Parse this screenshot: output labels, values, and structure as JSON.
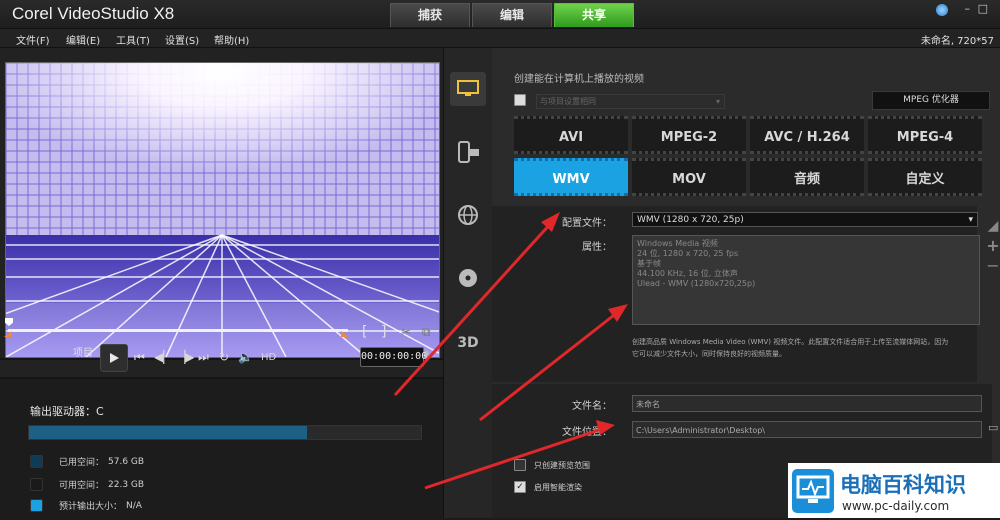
{
  "app": {
    "title": "Corel VideoStudio X8"
  },
  "tabs": [
    {
      "label": "捕获"
    },
    {
      "label": "编辑"
    },
    {
      "label": "共享",
      "active": true
    }
  ],
  "menu": [
    {
      "label": "文件(F)"
    },
    {
      "label": "编辑(E)"
    },
    {
      "label": "工具(T)"
    },
    {
      "label": "设置(S)"
    },
    {
      "label": "帮助(H)"
    }
  ],
  "project_info": "未命名, 720*57",
  "player": {
    "project_label": "项目",
    "hd_label": "HD",
    "timecode": "00:00:00:00",
    "mark_in": "[",
    "mark_out": "]"
  },
  "output": {
    "drive_label": "输出驱动器：C",
    "used_fraction": 0.71,
    "legend": [
      {
        "label": "已用空间：",
        "value": "57.6 GB",
        "color": "#0e3b55"
      },
      {
        "label": "可用空间：",
        "value": "22.3 GB",
        "color": "#1a1a1a"
      },
      {
        "label": "预计输出大小：",
        "value": "N/A",
        "color": "#1aa2e2"
      }
    ]
  },
  "share_targets": [
    {
      "icon": "computer-icon",
      "active": true
    },
    {
      "icon": "device-icon"
    },
    {
      "icon": "web-icon"
    },
    {
      "icon": "disc-icon"
    },
    {
      "icon": "3d-icon"
    }
  ],
  "computer": {
    "section_title": "创建能在计算机上播放的视频",
    "same_as_project": "与项目设置相同",
    "mpeg_opt_button": "MPEG 优化器",
    "formats": [
      {
        "label": "AVI"
      },
      {
        "label": "MPEG-2"
      },
      {
        "label": "AVC / H.264"
      },
      {
        "label": "MPEG-4"
      },
      {
        "label": "WMV",
        "active": true
      },
      {
        "label": "MOV"
      },
      {
        "label": "音频"
      },
      {
        "label": "自定义"
      }
    ],
    "profile_label": "配置文件：",
    "profile_value": "WMV (1280 x 720, 25p)",
    "props_label": "属性：",
    "props_lines": [
      "Windows Media 视频",
      "24 位, 1280 x 720, 25 fps",
      "基于帧",
      "44.100 KHz, 16 位, 立体声",
      "Ulead - WMV (1280x720,25p)"
    ],
    "description_line1": "创建高品质 Windows Media Video (WMV) 视频文件。此配置文件适合用于上传至流媒体网站，因为",
    "description_line2": "它可以减少文件大小，同时保持良好的视频质量。",
    "filename_label": "文件名：",
    "filename_value": "未命名",
    "location_label": "文件位置：",
    "location_value": "C:\\Users\\Administrator\\Desktop\\",
    "opt_preview_range": "只创建预览范围",
    "opt_smart_render": "启用智能渲染"
  },
  "watermark": {
    "title": "电脑百科知识",
    "url": "www.pc-daily.com"
  }
}
